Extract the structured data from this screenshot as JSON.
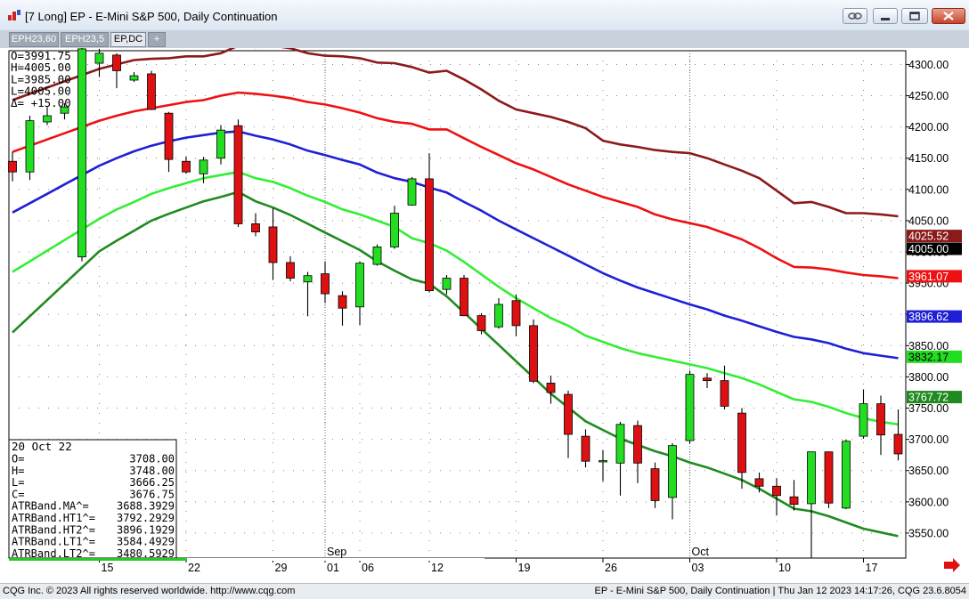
{
  "window": {
    "title": "[7 Long]  EP - E-Mini S&P 500, Daily Continuation",
    "tabs": [
      "EPH23,60",
      "EPH23,5",
      "EP,DC",
      "+"
    ],
    "active_tab": 2
  },
  "status": {
    "left": "CQG Inc. © 2023 All rights reserved worldwide. http://www.cqg.com",
    "right": "EP - E-Mini S&P 500, Daily Continuation | Thu Jan 12 2023 14:17:26, CQG 23.6.8054"
  },
  "ohlc_box": [
    {
      "label": "O=",
      "value": "3991.75"
    },
    {
      "label": "H=",
      "value": "4005.00"
    },
    {
      "label": "L=",
      "value": "3985.00"
    },
    {
      "label": "L=",
      "value": "4005.00"
    },
    {
      "label": "Δ=",
      "value": " +15.00"
    }
  ],
  "data_window": {
    "date": "20 Oct 22",
    "rows": [
      {
        "label": "O=",
        "value": "3708.00"
      },
      {
        "label": "H=",
        "value": "3748.00"
      },
      {
        "label": "L=",
        "value": "3666.25"
      },
      {
        "label": "C=",
        "value": "3676.75"
      },
      {
        "label": "ATRBand.MA^=",
        "value": "3688.3929"
      },
      {
        "label": "ATRBand.HT1^=",
        "value": "3792.2929"
      },
      {
        "label": "ATRBand.HT2^=",
        "value": "3896.1929"
      },
      {
        "label": "ATRBand.LT1^=",
        "value": "3584.4929"
      },
      {
        "label": "ATRBand.LT2^=",
        "value": "3480.5929"
      }
    ]
  },
  "price_labels": [
    {
      "value": "4025.52",
      "price": 4025.52,
      "color": "#8b1a1a",
      "text_color": "#ffffff"
    },
    {
      "value": "4005.00",
      "price": 4005.0,
      "color": "#000000",
      "text_color": "#ffffff"
    },
    {
      "value": "3961.07",
      "price": 3961.07,
      "color": "#ee1111",
      "text_color": "#ffffff"
    },
    {
      "value": "3896.62",
      "price": 3896.62,
      "color": "#1f1fd6",
      "text_color": "#ffffff"
    },
    {
      "value": "3832.17",
      "price": 3832.17,
      "color": "#22dd22",
      "text_color": "#000000"
    },
    {
      "value": "3767.72",
      "price": 3767.72,
      "color": "#1f8a1f",
      "text_color": "#ffffff"
    }
  ],
  "colors": {
    "up_candle": "#22dd22",
    "down_candle": "#dd1111",
    "ht2": "#8b1a1a",
    "ht1": "#ee1111",
    "ma": "#1f1fd6",
    "lt1": "#33ee33",
    "lt2": "#1f8a1f"
  },
  "chart_data": {
    "type": "candlestick",
    "title": "EP - E-Mini S&P 500, Daily Continuation",
    "ylim": [
      3510,
      4322
    ],
    "y_ticks": [
      3550,
      3600,
      3650,
      3700,
      3750,
      3800,
      3850,
      3900,
      3950,
      4000,
      4050,
      4100,
      4150,
      4200,
      4250,
      4300
    ],
    "y_tick_labels": [
      "3550.00",
      "3600.00",
      "3650.00",
      "3700.00",
      "3750.00",
      "3800.00",
      "3850.00",
      "3900.00",
      "3950.00",
      "4000.00",
      "4050.00",
      "4100.00",
      "4150.00",
      "4200.00",
      "4250.00",
      "4300.00"
    ],
    "x_labels": [
      {
        "label": "15",
        "index": 5
      },
      {
        "label": "22",
        "index": 10
      },
      {
        "label": "29",
        "index": 15
      },
      {
        "label": "01",
        "index": 18
      },
      {
        "label": "06",
        "index": 20
      },
      {
        "label": "12",
        "index": 24
      },
      {
        "label": "19",
        "index": 29
      },
      {
        "label": "26",
        "index": 34
      },
      {
        "label": "03",
        "index": 39
      },
      {
        "label": "10",
        "index": 44
      },
      {
        "label": "17",
        "index": 49
      }
    ],
    "month_labels": [
      {
        "label": "Sep",
        "index": 18
      },
      {
        "label": "Oct",
        "index": 39
      }
    ],
    "candles": [
      {
        "o": 4145,
        "h": 4160,
        "l": 4113,
        "c": 4128
      },
      {
        "o": 4128,
        "h": 4218,
        "l": 4115,
        "c": 4210
      },
      {
        "o": 4208,
        "h": 4232,
        "l": 4203,
        "c": 4218
      },
      {
        "o": 4222,
        "h": 4238,
        "l": 4212,
        "c": 4232
      },
      {
        "o": 3992,
        "h": 4330,
        "l": 3985,
        "c": 4325
      },
      {
        "o": 4302,
        "h": 4325,
        "l": 4280,
        "c": 4318
      },
      {
        "o": 4315,
        "h": 4318,
        "l": 4262,
        "c": 4290
      },
      {
        "o": 4275,
        "h": 4288,
        "l": 4272,
        "c": 4282
      },
      {
        "o": 4285,
        "h": 4290,
        "l": 4227,
        "c": 4228
      },
      {
        "o": 4222,
        "h": 4224,
        "l": 4128,
        "c": 4148
      },
      {
        "o": 4145,
        "h": 4153,
        "l": 4125,
        "c": 4128
      },
      {
        "o": 4125,
        "h": 4152,
        "l": 4110,
        "c": 4147
      },
      {
        "o": 4150,
        "h": 4203,
        "l": 4140,
        "c": 4195
      },
      {
        "o": 4202,
        "h": 4212,
        "l": 4040,
        "c": 4045
      },
      {
        "o": 4045,
        "h": 4062,
        "l": 4025,
        "c": 4032
      },
      {
        "o": 4040,
        "h": 4070,
        "l": 3955,
        "c": 3983
      },
      {
        "o": 3983,
        "h": 3993,
        "l": 3953,
        "c": 3958
      },
      {
        "o": 3952,
        "h": 3968,
        "l": 3897,
        "c": 3962
      },
      {
        "o": 3965,
        "h": 3985,
        "l": 3918,
        "c": 3933
      },
      {
        "o": 3930,
        "h": 3937,
        "l": 3882,
        "c": 3910
      },
      {
        "o": 3912,
        "h": 3985,
        "l": 3883,
        "c": 3982
      },
      {
        "o": 3980,
        "h": 4012,
        "l": 3978,
        "c": 4008
      },
      {
        "o": 4008,
        "h": 4074,
        "l": 4005,
        "c": 4062
      },
      {
        "o": 4075,
        "h": 4120,
        "l": 4074,
        "c": 4117
      },
      {
        "o": 4117,
        "h": 4158,
        "l": 3935,
        "c": 3938
      },
      {
        "o": 3940,
        "h": 3963,
        "l": 3932,
        "c": 3958
      },
      {
        "o": 3958,
        "h": 3963,
        "l": 3897,
        "c": 3898
      },
      {
        "o": 3898,
        "h": 3902,
        "l": 3868,
        "c": 3874
      },
      {
        "o": 3880,
        "h": 3926,
        "l": 3877,
        "c": 3916
      },
      {
        "o": 3922,
        "h": 3932,
        "l": 3865,
        "c": 3882
      },
      {
        "o": 3882,
        "h": 3892,
        "l": 3790,
        "c": 3793
      },
      {
        "o": 3790,
        "h": 3802,
        "l": 3757,
        "c": 3775
      },
      {
        "o": 3772,
        "h": 3778,
        "l": 3670,
        "c": 3708
      },
      {
        "o": 3705,
        "h": 3716,
        "l": 3655,
        "c": 3665
      },
      {
        "o": 3666,
        "h": 3683,
        "l": 3633,
        "c": 3666
      },
      {
        "o": 3662,
        "h": 3728,
        "l": 3610,
        "c": 3724
      },
      {
        "o": 3722,
        "h": 3730,
        "l": 3630,
        "c": 3662
      },
      {
        "o": 3653,
        "h": 3663,
        "l": 3590,
        "c": 3602
      },
      {
        "o": 3607,
        "h": 3694,
        "l": 3572,
        "c": 3690
      },
      {
        "o": 3698,
        "h": 3810,
        "l": 3693,
        "c": 3804
      },
      {
        "o": 3798,
        "h": 3806,
        "l": 3782,
        "c": 3794
      },
      {
        "o": 3794,
        "h": 3818,
        "l": 3748,
        "c": 3753
      },
      {
        "o": 3742,
        "h": 3750,
        "l": 3621,
        "c": 3647
      },
      {
        "o": 3637,
        "h": 3647,
        "l": 3615,
        "c": 3625
      },
      {
        "o": 3625,
        "h": 3638,
        "l": 3578,
        "c": 3610
      },
      {
        "o": 3608,
        "h": 3635,
        "l": 3586,
        "c": 3596
      },
      {
        "o": 3597,
        "h": 3680,
        "l": 3510,
        "c": 3680
      },
      {
        "o": 3680,
        "h": 3680,
        "l": 3590,
        "c": 3598
      },
      {
        "o": 3590,
        "h": 3700,
        "l": 3588,
        "c": 3697
      },
      {
        "o": 3705,
        "h": 3780,
        "l": 3701,
        "c": 3757
      },
      {
        "o": 3757,
        "h": 3770,
        "l": 3675,
        "c": 3707
      },
      {
        "o": 3708,
        "h": 3748,
        "l": 3666.25,
        "c": 3676.75
      }
    ],
    "series": [
      {
        "key": "ht2",
        "values": [
          4243,
          4253,
          4263,
          4273,
          4283,
          4293,
          4300,
          4307,
          4309,
          4310,
          4313,
          4313,
          4318,
          4330,
          4328,
          4330,
          4326,
          4318,
          4314,
          4313,
          4310,
          4303,
          4302,
          4296,
          4287,
          4290,
          4276,
          4260,
          4242,
          4228,
          4222,
          4216,
          4208,
          4198,
          4178,
          4172,
          4168,
          4163,
          4160,
          4158,
          4150,
          4140,
          4130,
          4118,
          4098,
          4078,
          4080,
          4072,
          4062,
          4062,
          4060,
          4057
        ]
      },
      {
        "key": "ht1",
        "values": [
          4160,
          4170,
          4180,
          4190,
          4200,
          4210,
          4218,
          4225,
          4230,
          4235,
          4240,
          4243,
          4250,
          4255,
          4253,
          4250,
          4246,
          4240,
          4236,
          4230,
          4223,
          4214,
          4208,
          4205,
          4196,
          4196,
          4182,
          4168,
          4155,
          4142,
          4132,
          4120,
          4108,
          4098,
          4088,
          4080,
          4072,
          4060,
          4052,
          4046,
          4040,
          4030,
          4020,
          4006,
          3990,
          3976,
          3975,
          3972,
          3967,
          3963,
          3961,
          3958
        ]
      },
      {
        "key": "ma",
        "values": [
          4063,
          4078,
          4093,
          4108,
          4123,
          4138,
          4150,
          4161,
          4170,
          4177,
          4183,
          4187,
          4191,
          4193,
          4186,
          4180,
          4172,
          4162,
          4155,
          4147,
          4140,
          4127,
          4118,
          4112,
          4103,
          4095,
          4080,
          4066,
          4050,
          4036,
          4022,
          4008,
          3994,
          3980,
          3966,
          3954,
          3943,
          3934,
          3925,
          3916,
          3908,
          3898,
          3890,
          3881,
          3872,
          3864,
          3860,
          3854,
          3845,
          3838,
          3834,
          3830
        ]
      },
      {
        "key": "lt1",
        "values": [
          3968,
          3985,
          4002,
          4019,
          4036,
          4053,
          4068,
          4080,
          4093,
          4102,
          4110,
          4118,
          4123,
          4128,
          4118,
          4112,
          4102,
          4090,
          4080,
          4068,
          4060,
          4050,
          4040,
          4022,
          4014,
          4002,
          3984,
          3964,
          3944,
          3926,
          3910,
          3894,
          3882,
          3866,
          3856,
          3846,
          3838,
          3832,
          3826,
          3820,
          3814,
          3806,
          3798,
          3788,
          3776,
          3764,
          3760,
          3752,
          3742,
          3734,
          3728,
          3724
        ]
      },
      {
        "key": "lt2",
        "values": [
          3871,
          3897,
          3923,
          3949,
          3975,
          4001,
          4018,
          4034,
          4050,
          4061,
          4071,
          4081,
          4088,
          4096,
          4081,
          4071,
          4059,
          4045,
          4031,
          4017,
          4003,
          3985,
          3970,
          3956,
          3949,
          3929,
          3903,
          3877,
          3851,
          3825,
          3799,
          3773,
          3751,
          3729,
          3715,
          3701,
          3691,
          3681,
          3673,
          3663,
          3655,
          3645,
          3635,
          3621,
          3605,
          3589,
          3585,
          3577,
          3567,
          3557,
          3551,
          3545
        ]
      }
    ]
  }
}
